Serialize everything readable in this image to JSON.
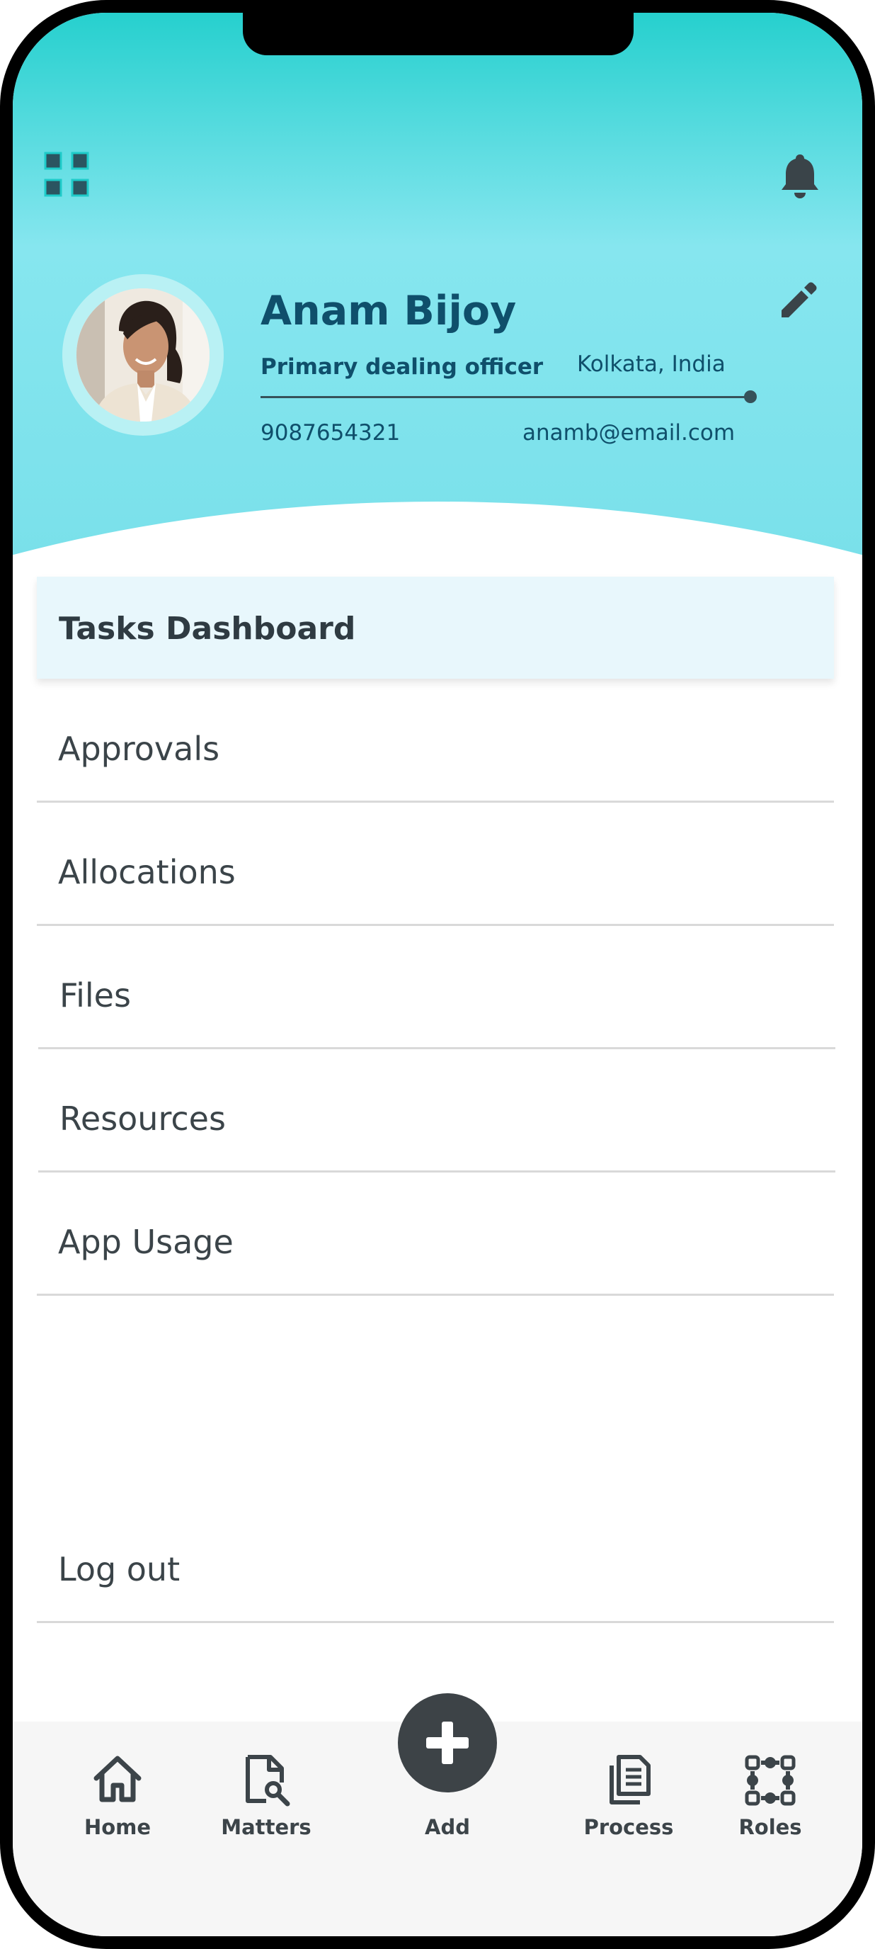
{
  "profile": {
    "name": "Anam Bijoy",
    "role": "Primary dealing officer",
    "location": "Kolkata, India",
    "phone": "9087654321",
    "email": "anamb@email.com"
  },
  "menu": {
    "active": "Tasks Dashboard",
    "items": [
      {
        "label": "Approvals"
      },
      {
        "label": "Allocations"
      },
      {
        "label": "Files"
      },
      {
        "label": "Resources"
      },
      {
        "label": "App Usage"
      }
    ],
    "logout": "Log out"
  },
  "nav": {
    "home": "Home",
    "matters": "Matters",
    "add": "Add",
    "process": "Process",
    "roles": "Roles"
  },
  "colors": {
    "header_top": "#26d0ce",
    "header_bottom": "#79e0ea",
    "name_text": "#0f4f6b",
    "active_row": "#e8f7fc",
    "add_button": "#3d4347"
  },
  "icons": {
    "grid": "grid-icon",
    "bell": "bell-icon",
    "edit": "pencil-icon",
    "home": "home-icon",
    "matters": "document-search-icon",
    "add": "plus-icon",
    "process": "documents-icon",
    "roles": "network-icon"
  }
}
